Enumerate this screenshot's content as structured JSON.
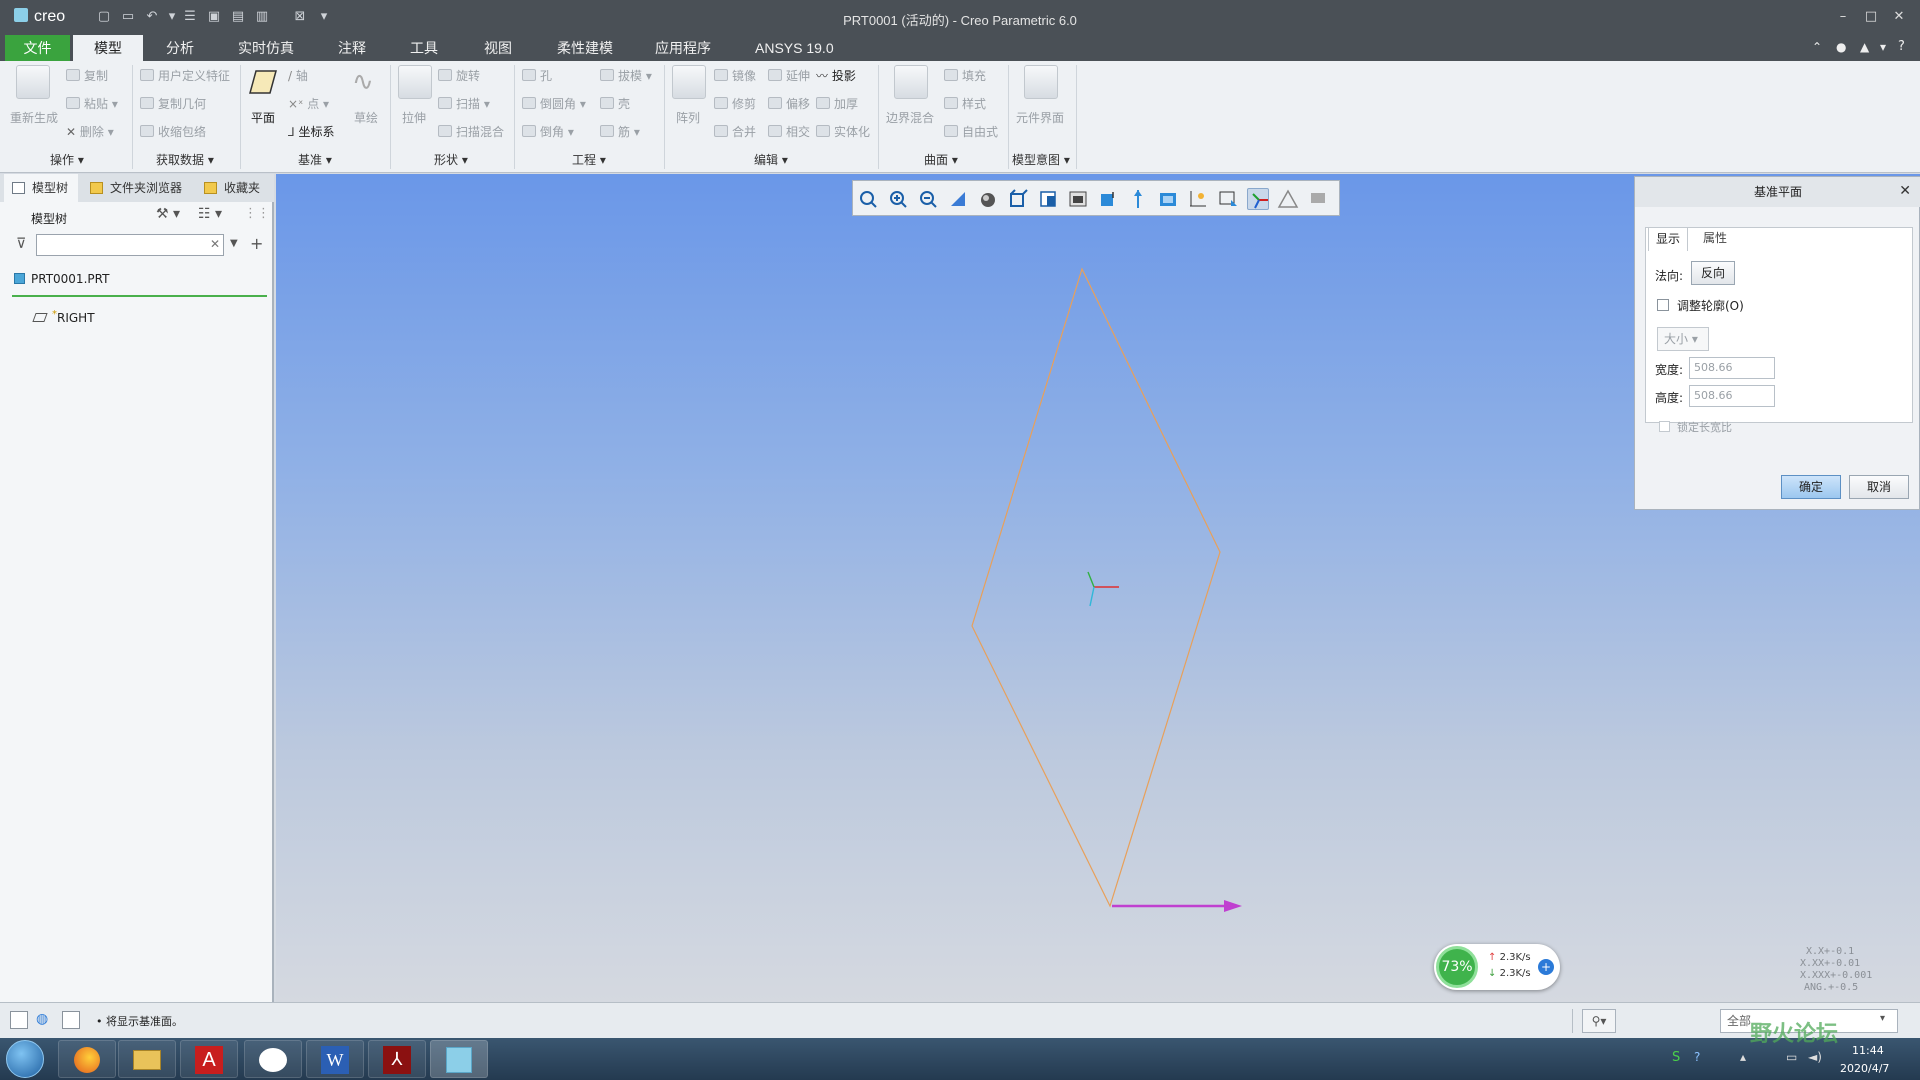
{
  "app": {
    "logo": "creo",
    "window_title": "PRT0001 (活动的) - Creo Parametric 6.0"
  },
  "tabs": [
    "文件",
    "模型",
    "分析",
    "实时仿真",
    "注释",
    "工具",
    "视图",
    "柔性建模",
    "应用程序",
    "ANSYS 19.0"
  ],
  "ribbon": {
    "operations": {
      "regen": "重新生成",
      "copy": "复制",
      "paste": "粘贴",
      "delete": "删除",
      "label": "操作"
    },
    "get_data": {
      "udf": "用户定义特征",
      "copy_geom": "复制几何",
      "shrinkwrap": "收缩包络",
      "label": "获取数据"
    },
    "datum": {
      "plane": "平面",
      "axis": "轴",
      "point": "点",
      "csys": "坐标系",
      "sketch": "草绘",
      "label": "基准"
    },
    "shapes": {
      "extrude": "拉伸",
      "revolve": "旋转",
      "sweep": "扫描",
      "swept_blend": "扫描混合",
      "label": "形状"
    },
    "engineering": {
      "hole": "孔",
      "round": "倒圆角",
      "chamfer": "倒角",
      "draft": "拔模",
      "shell": "壳",
      "rib": "筋",
      "label": "工程"
    },
    "editing": {
      "pattern": "阵列",
      "mirror": "镜像",
      "extend": "延伸",
      "project": "投影",
      "trim": "修剪",
      "offset": "偏移",
      "thicken": "加厚",
      "merge": "合并",
      "intersect": "相交",
      "solidify": "实体化",
      "label": "编辑"
    },
    "surfaces": {
      "boundary_blend": "边界混合",
      "fill": "填充",
      "style": "样式",
      "freestyle": "自由式",
      "label": "曲面"
    },
    "model_intent": {
      "component_interface": "元件界面",
      "label": "模型意图"
    }
  },
  "left_panel": {
    "tabs": [
      "模型树",
      "文件夹浏览器",
      "收藏夹"
    ],
    "tree_header": "模型树",
    "tree_items": [
      {
        "label": "PRT0001.PRT"
      },
      {
        "label": "RIGHT",
        "prefix": "*"
      }
    ]
  },
  "dialog": {
    "title": "基准平面",
    "tabs": [
      "显示",
      "属性"
    ],
    "normal_label": "法向:",
    "flip_button": "反向",
    "adjust_outline": "调整轮廓(O)",
    "size_option": "大小",
    "width_label": "宽度:",
    "width_value": "508.66",
    "height_label": "高度:",
    "height_value": "508.66",
    "lock_ratio": "锁定长宽比",
    "ok": "确定",
    "cancel": "取消"
  },
  "status": {
    "message": "• 将显示基准面。",
    "filter": "全部"
  },
  "network": {
    "percent": "73%",
    "up": "2.3K/s",
    "down": "2.3K/s"
  },
  "tolerances": [
    "X.X+-0.1",
    "X.XX+-0.01",
    "X.XXX+-0.001",
    "ANG.+-0.5"
  ],
  "clock": {
    "time": "11:44",
    "date": "2020/4/7"
  },
  "watermark": "野火论坛",
  "colors": {
    "file_tab": "#3aa33e",
    "plane_outline": "#e8a05a",
    "arrow": "#c040d0"
  }
}
